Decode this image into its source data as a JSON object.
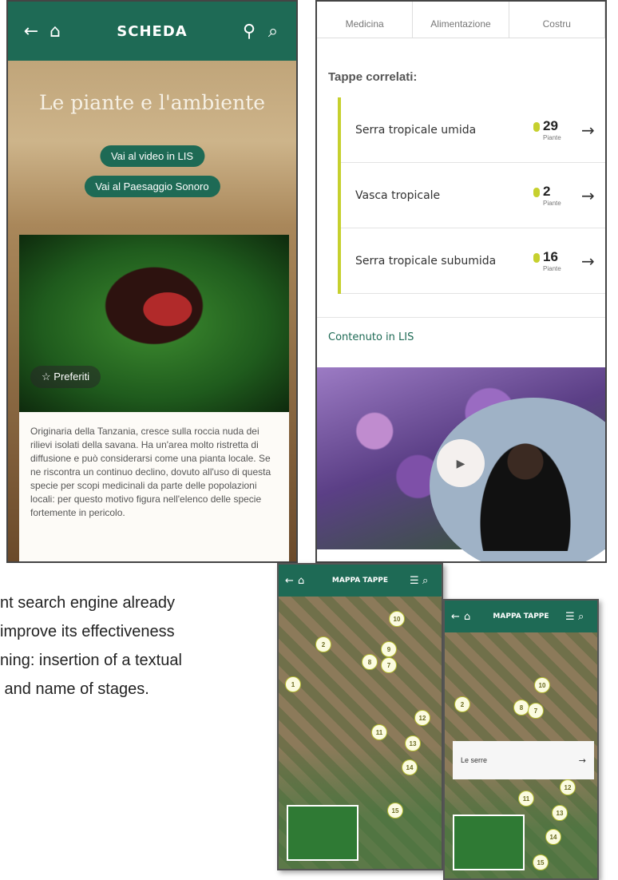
{
  "scheda": {
    "back_icon": "arrow-left-icon",
    "home_icon": "home-icon",
    "title": "SCHEDA",
    "map_icon": "map-icon",
    "search_icon": "search-icon",
    "hero_title": "Le piante e l'ambiente",
    "btn_video_lis": "Vai al video in LIS",
    "btn_paesaggio": "Vai al Paesaggio Sonoro",
    "fav_icon": "star-icon",
    "fav_label": "Preferiti",
    "description": "Originaria della Tanzania, cresce sulla roccia nuda dei rilievi isolati della savana. Ha un'area molto ristretta di diffusione e può considerarsi come una pianta locale. Se ne riscontra un continuo declino, dovuto all'uso di questa specie per scopi medicinali da parte delle popolazioni locali: per questo motivo figura nell'elenco delle specie fortemente in pericolo."
  },
  "tappe": {
    "categories": [
      "Medicina",
      "Alimentazione",
      "Costru"
    ],
    "section_title": "Tappe correlati:",
    "rows": [
      {
        "label": "Serra tropicale umida",
        "count": "29",
        "unit": "Piante"
      },
      {
        "label": "Vasca tropicale",
        "count": "2",
        "unit": "Piante"
      },
      {
        "label": "Serra tropicale subumida",
        "count": "16",
        "unit": "Piante"
      }
    ],
    "arrow_icon": "arrow-right-icon",
    "lis_title": "Contenuto in LIS",
    "play_icon": "play-icon"
  },
  "body_text": "nt search engine already\nimprove its effectiveness\nning: insertion of a textual\n and name of stages.",
  "map1": {
    "title": "MAPPA TAPPE",
    "list_icon": "list-icon",
    "search_icon": "search-icon",
    "markers": [
      "1",
      "2",
      "10",
      "9",
      "8",
      "7",
      "11",
      "12",
      "13",
      "14",
      "15"
    ]
  },
  "map2": {
    "title": "MAPPA TAPPE",
    "list_icon": "list-icon",
    "search_icon": "search-icon",
    "markers": [
      "2",
      "10",
      "8",
      "7",
      "11",
      "12",
      "13",
      "14",
      "15"
    ],
    "popup_title": "Le serre",
    "popup_arrow": "→"
  },
  "colors": {
    "primary": "#1e6a55",
    "accent": "#c6d02e"
  }
}
